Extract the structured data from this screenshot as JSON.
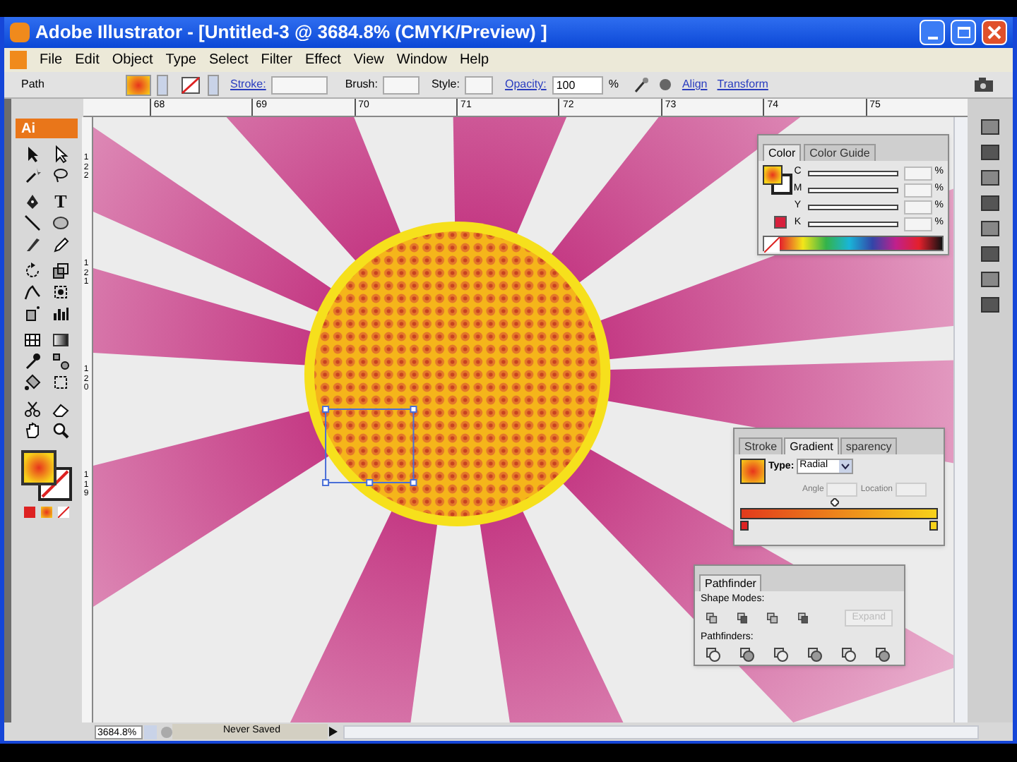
{
  "window": {
    "title": "Adobe Illustrator - [Untitled-3 @ 3684.8% (CMYK/Preview) ]"
  },
  "menu": [
    "File",
    "Edit",
    "Object",
    "Type",
    "Select",
    "Filter",
    "Effect",
    "View",
    "Window",
    "Help"
  ],
  "control_bar": {
    "selection": "Path",
    "stroke_label": "Stroke:",
    "brush_label": "Brush:",
    "style_label": "Style:",
    "opacity_label": "Opacity:",
    "opacity_value": "100",
    "percent": "%",
    "links": [
      "Align",
      "Transform"
    ]
  },
  "ruler": {
    "ticks": [
      "68",
      "69",
      "70",
      "71",
      "72",
      "73",
      "74",
      "75"
    ],
    "vertical_ticks": [
      "122",
      "121",
      "120",
      "119"
    ]
  },
  "tools": {
    "logo": "Ai",
    "type_glyph": "T"
  },
  "color_panel": {
    "tabs": [
      {
        "label": "Color",
        "selected": true
      },
      {
        "label": "Color Guide",
        "selected": false
      }
    ],
    "channels": [
      {
        "label": "C",
        "unit": "%"
      },
      {
        "label": "M",
        "unit": "%"
      },
      {
        "label": "Y",
        "unit": "%"
      },
      {
        "label": "K",
        "unit": "%"
      }
    ]
  },
  "gradient_panel": {
    "tabs": [
      {
        "label": "Stroke",
        "selected": false
      },
      {
        "label": "Gradient",
        "selected": true
      },
      {
        "label": "sparency",
        "selected": false
      }
    ],
    "type_label": "Type:",
    "type_value": "Radial",
    "fields": [
      {
        "label": "Angle",
        "disabled": true
      },
      {
        "label": "Location",
        "disabled": true
      }
    ]
  },
  "pathfinder_panel": {
    "tabs": [
      {
        "label": "Pathfinder",
        "selected": true
      }
    ],
    "shape_modes_label": "Shape Modes:",
    "expand_button": {
      "label": "Expand",
      "disabled": true
    },
    "pathfinders_label": "Pathfinders:"
  },
  "status_bar": {
    "zoom": "3684.8%",
    "status": "Never Saved"
  }
}
